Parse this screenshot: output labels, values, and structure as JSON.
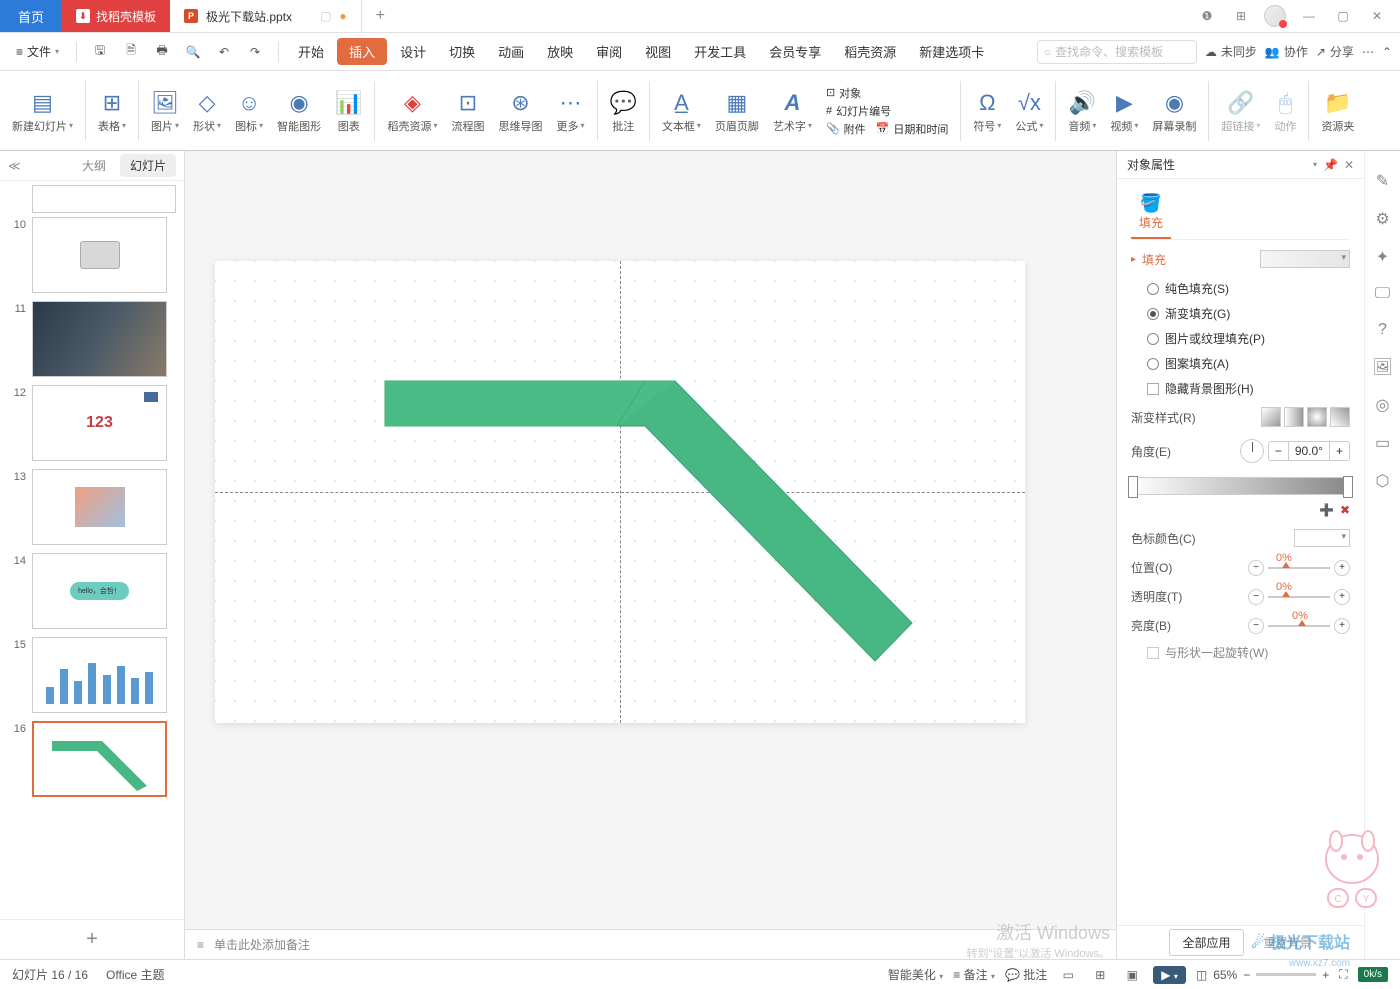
{
  "titlebar": {
    "home": "首页",
    "template": "找稻壳模板",
    "doc": "极光下载站.pptx",
    "add": "+"
  },
  "menubar": {
    "file": "文件",
    "items": [
      "开始",
      "插入",
      "设计",
      "切换",
      "动画",
      "放映",
      "审阅",
      "视图",
      "开发工具",
      "会员专享",
      "稻壳资源",
      "新建选项卡"
    ],
    "active_index": 1,
    "search_placeholder": "查找命令、搜索模板",
    "unsync": "未同步",
    "collab": "协作",
    "share": "分享"
  },
  "ribbon": {
    "items": [
      "新建幻灯片",
      "表格",
      "图片",
      "形状",
      "图标",
      "智能图形",
      "图表",
      "稻壳资源",
      "流程图",
      "思维导图",
      "更多",
      "批注",
      "文本框",
      "页眉页脚",
      "艺术字",
      "对象",
      "幻灯片编号",
      "附件",
      "日期和时间",
      "符号",
      "公式",
      "音频",
      "视频",
      "屏幕录制",
      "超链接",
      "动作",
      "资源夹"
    ]
  },
  "slide_panel": {
    "outline": "大纲",
    "slides": "幻灯片",
    "numbers": [
      "10",
      "11",
      "12",
      "13",
      "14",
      "15",
      "16"
    ],
    "twelve_text": "123",
    "bubble_text": "hello，会哲！"
  },
  "notes_placeholder": "单击此处添加备注",
  "props": {
    "title": "对象属性",
    "fill_tab": "填充",
    "section": "填充",
    "solid": "纯色填充(S)",
    "gradient": "渐变填充(G)",
    "picture": "图片或纹理填充(P)",
    "pattern": "图案填充(A)",
    "hide_bg": "隐藏背景图形(H)",
    "grad_style": "渐变样式(R)",
    "angle": "角度(E)",
    "angle_val": "90.0°",
    "stop_color": "色标颜色(C)",
    "position": "位置(O)",
    "transparency": "透明度(T)",
    "brightness": "亮度(B)",
    "pct": "0%",
    "rotate_with": "与形状一起旋转(W)",
    "apply_all": "全部应用",
    "reset_bg": "重置背景"
  },
  "statusbar": {
    "slide_count": "幻灯片 16 / 16",
    "theme": "Office 主题",
    "beautify": "智能美化",
    "notes": "备注",
    "comments": "批注",
    "zoom": "65%",
    "net": "0k/s"
  },
  "watermark": {
    "title": "极光下载站",
    "url": "www.xz7.com"
  },
  "windows": {
    "l1": "激活 Windows",
    "l2": "转到\"设置\"以激活 Windows。"
  }
}
